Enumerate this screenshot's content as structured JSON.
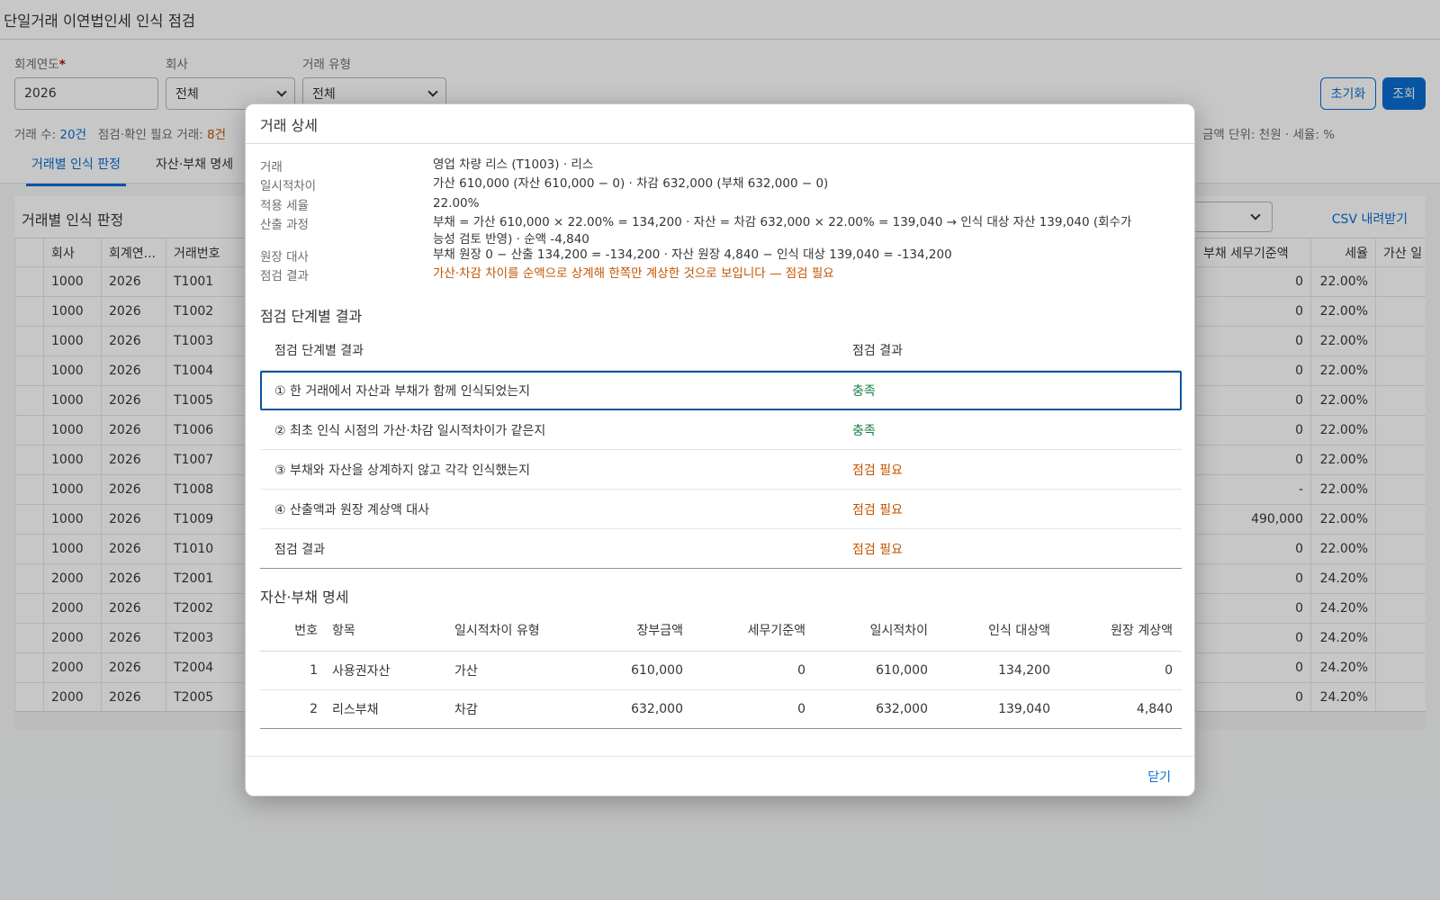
{
  "page": {
    "title": "단일거래 이연법인세 인식 점검",
    "filters": {
      "year_label": "회계연도",
      "year_required": "*",
      "year_value": "2026",
      "company_label": "회사",
      "company_value": "전체",
      "type_label": "거래 유형",
      "type_value": "전체"
    },
    "reset_label": "초기화",
    "search_label": "조회",
    "summary": {
      "tx_count_label": "거래 수:",
      "tx_count": "20건",
      "check_label": "점검·확인 필요 거래:",
      "check_count": "8건",
      "unit_text": "금액 단위: 천원 · 세율: %"
    },
    "tabs": [
      "거래별 인식 판정",
      "자산·부채 명세"
    ],
    "card": {
      "title": "거래별 인식 판정",
      "select_value": "체",
      "csv_label": "CSV 내려받기"
    },
    "grid": {
      "headers": [
        "회사",
        "회계연...",
        "거래번호",
        "부채 세무기준액",
        "세율",
        "가산 일"
      ],
      "rows": [
        {
          "company": "1000",
          "year": "2026",
          "tx": "T1001",
          "liab_tax": "0",
          "rate": "22.00%"
        },
        {
          "company": "1000",
          "year": "2026",
          "tx": "T1002",
          "liab_tax": "0",
          "rate": "22.00%"
        },
        {
          "company": "1000",
          "year": "2026",
          "tx": "T1003",
          "liab_tax": "0",
          "rate": "22.00%"
        },
        {
          "company": "1000",
          "year": "2026",
          "tx": "T1004",
          "liab_tax": "0",
          "rate": "22.00%"
        },
        {
          "company": "1000",
          "year": "2026",
          "tx": "T1005",
          "liab_tax": "0",
          "rate": "22.00%"
        },
        {
          "company": "1000",
          "year": "2026",
          "tx": "T1006",
          "liab_tax": "0",
          "rate": "22.00%"
        },
        {
          "company": "1000",
          "year": "2026",
          "tx": "T1007",
          "liab_tax": "0",
          "rate": "22.00%"
        },
        {
          "company": "1000",
          "year": "2026",
          "tx": "T1008",
          "liab_tax": "-",
          "rate": "22.00%"
        },
        {
          "company": "1000",
          "year": "2026",
          "tx": "T1009",
          "liab_tax": "490,000",
          "rate": "22.00%"
        },
        {
          "company": "1000",
          "year": "2026",
          "tx": "T1010",
          "liab_tax": "0",
          "rate": "22.00%"
        },
        {
          "company": "2000",
          "year": "2026",
          "tx": "T2001",
          "liab_tax": "0",
          "rate": "24.20%"
        },
        {
          "company": "2000",
          "year": "2026",
          "tx": "T2002",
          "liab_tax": "0",
          "rate": "24.20%"
        },
        {
          "company": "2000",
          "year": "2026",
          "tx": "T2003",
          "liab_tax": "0",
          "rate": "24.20%"
        },
        {
          "company": "2000",
          "year": "2026",
          "tx": "T2004",
          "liab_tax": "0",
          "rate": "24.20%"
        },
        {
          "company": "2000",
          "year": "2026",
          "tx": "T2005",
          "liab_tax": "0",
          "rate": "24.20%"
        }
      ]
    }
  },
  "dialog": {
    "title": "거래 상세",
    "details": [
      {
        "key": "거래",
        "value": "영업 차량 리스 (T1003) · 리스",
        "warn": false
      },
      {
        "key": "일시적차이",
        "value": "가산 610,000 (자산 610,000 − 0) · 차감 632,000 (부채 632,000 − 0)",
        "warn": false
      },
      {
        "key": "적용 세율",
        "value": "22.00%",
        "warn": false
      },
      {
        "key": "산출 과정",
        "value": "부채 = 가산 610,000 × 22.00% = 134,200 · 자산 = 차감 632,000 × 22.00% = 139,040 → 인식 대상 자산 139,040 (회수가능성 검토 반영) · 순액 -4,840",
        "warn": false
      },
      {
        "key": "원장 대사",
        "value": "부채 원장 0 − 산출 134,200 = -134,200 · 자산 원장 4,840 − 인식 대상 139,040 = -134,200",
        "warn": false
      },
      {
        "key": "점검 결과",
        "value": "가산·차감 차이를 순액으로 상계해 한쪽만 계상한 것으로 보입니다 — 점검 필요",
        "warn": true
      }
    ],
    "check_section_title": "점검 단계별 결과",
    "check_headers": [
      "점검 단계별 결과",
      "점검 결과"
    ],
    "checks": [
      {
        "step": "① 한 거래에서 자산과 부채가 함께 인식되었는지",
        "result": "충족",
        "ok": true
      },
      {
        "step": "② 최초 인식 시점의 가산·차감 일시적차이가 같은지",
        "result": "충족",
        "ok": true
      },
      {
        "step": "③ 부채와 자산을 상계하지 않고 각각 인식했는지",
        "result": "점검 필요",
        "ok": false
      },
      {
        "step": "④ 산출액과 원장 계상액 대사",
        "result": "점검 필요",
        "ok": false
      },
      {
        "step": "점검 결과",
        "result": "점검 필요",
        "ok": false
      }
    ],
    "detail_section_title": "자산·부채 명세",
    "detail_headers": [
      "번호",
      "항목",
      "일시적차이 유형",
      "장부금액",
      "세무기준액",
      "일시적차이",
      "인식 대상액",
      "원장 계상액"
    ],
    "detail_rows": [
      {
        "no": "1",
        "item": "사용권자산",
        "type": "가산",
        "book": "610,000",
        "tax": "0",
        "diff": "610,000",
        "recog": "134,200",
        "ledger": "0"
      },
      {
        "no": "2",
        "item": "리스부채",
        "type": "차감",
        "book": "632,000",
        "tax": "0",
        "diff": "632,000",
        "recog": "139,040",
        "ledger": "4,840"
      }
    ],
    "close_label": "닫기"
  }
}
